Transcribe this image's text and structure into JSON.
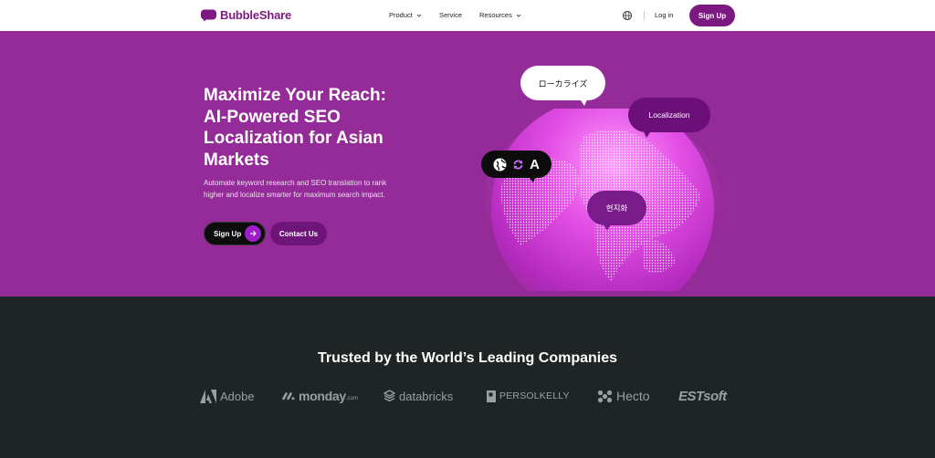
{
  "brand": {
    "name": "BubbleShare",
    "accent": "#7d1a82",
    "hero_bg": "#952b98",
    "dark_bg": "#1f2424"
  },
  "nav": {
    "product": "Product",
    "service": "Service",
    "resources": "Resources",
    "login": "Log in",
    "signup": "Sign Up"
  },
  "hero": {
    "title_lines": [
      "Maximize Your Reach:",
      "AI-Powered SEO",
      "Localization for Asian",
      "Markets"
    ],
    "description_lines": [
      "Automate keyword research and SEO translation to rank",
      "higher and localize smarter for maximum search impact."
    ],
    "signup": "Sign Up",
    "contact": "Contact Us",
    "bubbles": {
      "japanese": "ローカライズ",
      "english": "Localization",
      "korean": "현지화",
      "translate_letter": "A"
    }
  },
  "trusted": {
    "title": "Trusted by the World’s Leading Companies",
    "companies": [
      "Adobe",
      "monday",
      ".com",
      "databricks",
      "PERSOLKELLY",
      "Hecto",
      "ESTsoft"
    ]
  }
}
